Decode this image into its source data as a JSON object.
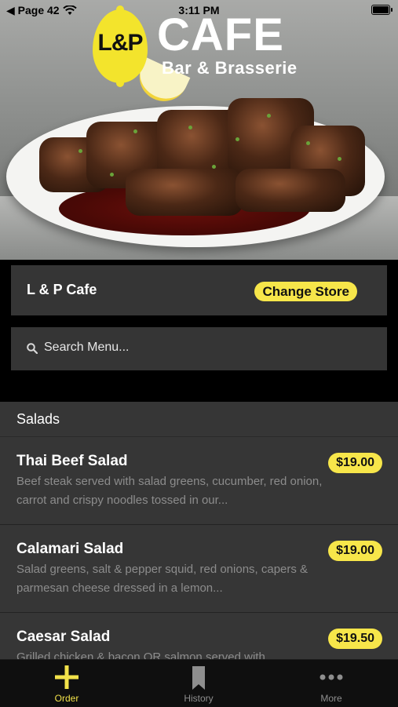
{
  "status_bar": {
    "back_label": "◀ Page 42",
    "time": "3:11 PM"
  },
  "header": {
    "logo_mark": "L&P",
    "logo_title": "CAFE",
    "logo_subtitle": "Bar & Brasserie"
  },
  "store": {
    "name": "L & P Cafe",
    "change_label": "Change Store"
  },
  "search": {
    "placeholder": "Search Menu..."
  },
  "menu": {
    "section_title": "Salads",
    "items": [
      {
        "name": "Thai Beef Salad",
        "price": "$19.00",
        "description": "Beef steak served with salad greens, cucumber, red onion, carrot and crispy noodles tossed in our..."
      },
      {
        "name": "Calamari Salad",
        "price": "$19.00",
        "description": "Salad greens, salt & pepper squid, red onions, capers & parmesan cheese dressed in a lemon..."
      },
      {
        "name": "Caesar Salad",
        "price": "$19.50",
        "description": "Grilled chicken & bacon OR salmon served with..."
      }
    ]
  },
  "tabbar": {
    "tabs": [
      {
        "label": "Order",
        "icon": "plus-icon",
        "active": true
      },
      {
        "label": "History",
        "icon": "bookmark-icon",
        "active": false
      },
      {
        "label": "More",
        "icon": "more-icon",
        "active": false
      }
    ]
  },
  "colors": {
    "accent": "#f7e64a",
    "panel": "#353535",
    "background": "#000000"
  }
}
